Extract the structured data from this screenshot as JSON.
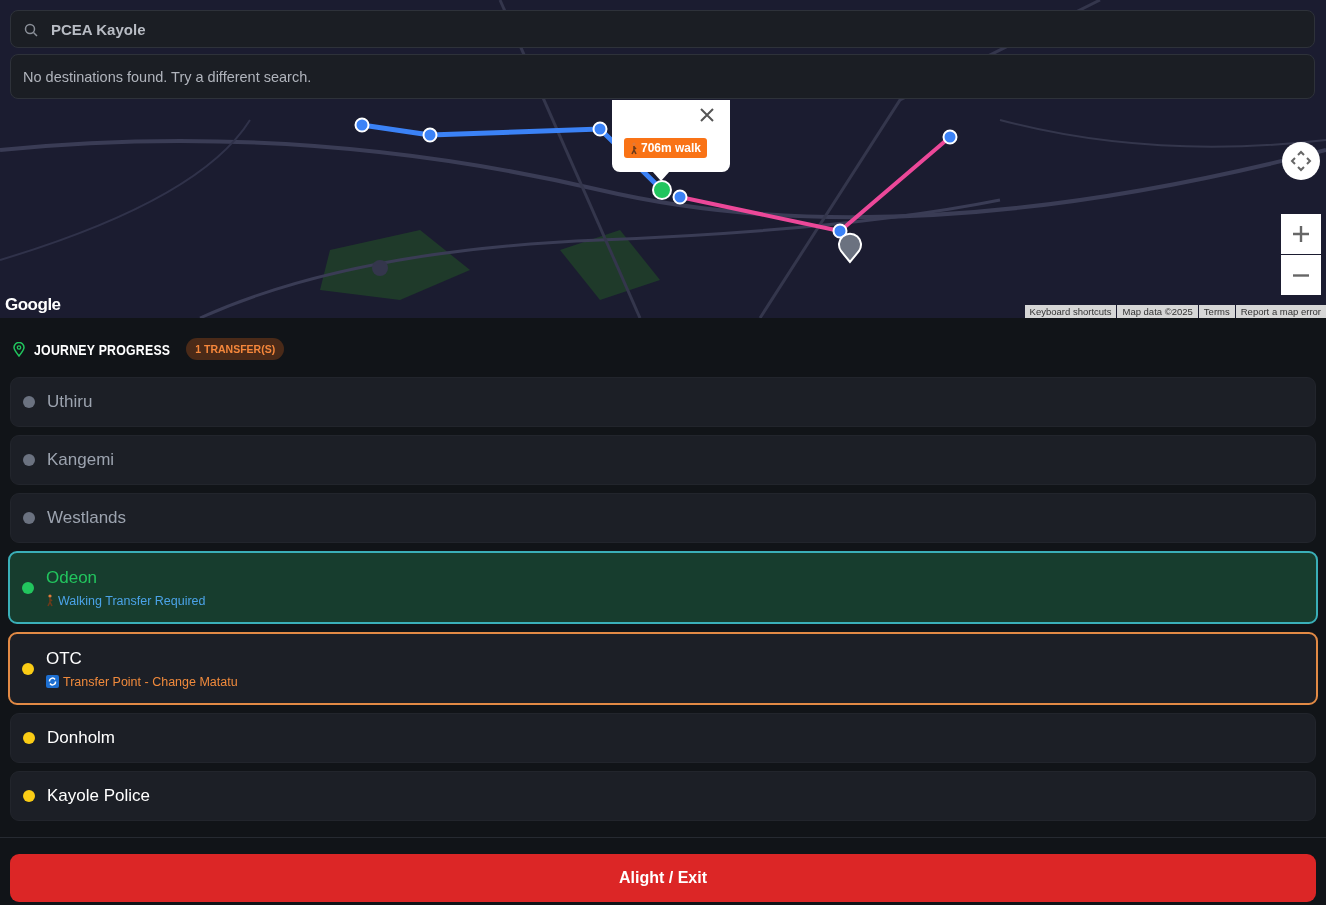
{
  "search": {
    "value": "PCEA Kayole",
    "message": "No destinations found. Try a different search."
  },
  "map": {
    "kind": "picture",
    "popup": {
      "badge": "706m walk"
    },
    "logo": "Google",
    "attribution": [
      "Keyboard shortcuts",
      "Map data ©2025",
      "Terms",
      "Report a map error"
    ]
  },
  "journey": {
    "title": "JOURNEY PROGRESS",
    "badge": "1 TRANSFER(S)",
    "stops": [
      {
        "name": "Uthiru",
        "kind": "passed"
      },
      {
        "name": "Kangemi",
        "kind": "passed"
      },
      {
        "name": "Westlands",
        "kind": "passed"
      },
      {
        "name": "Odeon",
        "kind": "current",
        "note": {
          "kind": "walk",
          "text": "Walking Transfer Required"
        }
      },
      {
        "name": "OTC",
        "kind": "transfer",
        "note": {
          "kind": "transfer",
          "text": "Transfer Point - Change Matatu"
        }
      },
      {
        "name": "Donholm",
        "kind": "upcoming"
      },
      {
        "name": "Kayole Police",
        "kind": "upcoming"
      }
    ]
  },
  "action": {
    "label": "Alight / Exit"
  }
}
